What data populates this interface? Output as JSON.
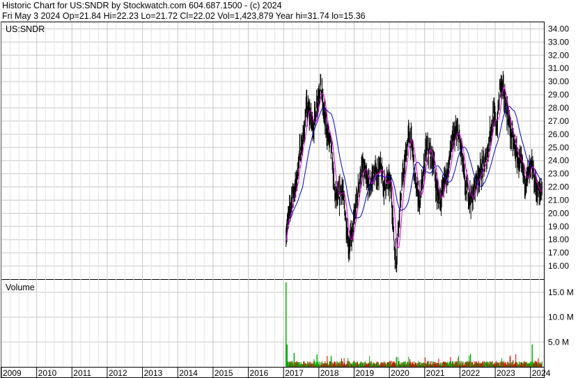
{
  "header": {
    "title": "Historic Chart for US:SNDR by Stockwatch.com 604.687.1500 - (c) 2024",
    "quote": "Fri May  3 2024   Op=21.84  Hi=22.23  Lo=21.72  Cl=22.02  Vol=1,423,879  Year hi=31.74  lo=15.36"
  },
  "price_panel": {
    "label": "US:SNDR"
  },
  "volume_panel": {
    "label": "Volume"
  },
  "colors": {
    "bars": "#000000",
    "ma_short": "#e000e0",
    "ma_long": "#0000d0",
    "vol_up": "#00b000",
    "vol_down": "#e00000",
    "grid": "#c8c8c8"
  },
  "chart_data": [
    {
      "type": "line",
      "title": "US:SNDR",
      "price_ticks": [
        "16.00",
        "17.00",
        "18.00",
        "19.00",
        "20.00",
        "21.00",
        "22.00",
        "23.00",
        "24.00",
        "25.00",
        "26.00",
        "27.00",
        "28.00",
        "29.00",
        "30.00",
        "31.00",
        "32.00",
        "33.00",
        "34.00"
      ],
      "ylim": [
        15,
        34.5
      ],
      "x_ticks": [
        "2009",
        "2010",
        "2011",
        "2012",
        "2013",
        "2014",
        "2015",
        "2016",
        "2017",
        "2018",
        "2019",
        "2020",
        "2021",
        "2022",
        "2023",
        "2024"
      ],
      "series": [
        {
          "x": [
            2017.07,
            2017.15,
            2017.25,
            2017.35,
            2017.45,
            2017.55,
            2017.65,
            2017.75,
            2017.85,
            2017.95,
            2018.05,
            2018.15,
            2018.25,
            2018.35,
            2018.45,
            2018.55,
            2018.65,
            2018.75,
            2018.85,
            2018.95,
            2019.05,
            2019.15,
            2019.25,
            2019.35,
            2019.45,
            2019.55,
            2019.65,
            2019.75,
            2019.85,
            2019.95,
            2020.05,
            2020.15,
            2020.2,
            2020.25,
            2020.35,
            2020.45,
            2020.55,
            2020.65,
            2020.75,
            2020.85,
            2020.95,
            2021.05,
            2021.15,
            2021.25,
            2021.35,
            2021.45,
            2021.55,
            2021.65,
            2021.75,
            2021.85,
            2021.95,
            2022.05,
            2022.15,
            2022.25,
            2022.35,
            2022.45,
            2022.55,
            2022.65,
            2022.75,
            2022.85,
            2022.95,
            2023.05,
            2023.15,
            2023.25,
            2023.35,
            2023.45,
            2023.55,
            2023.65,
            2023.75,
            2023.85,
            2023.95,
            2024.05,
            2024.15,
            2024.25,
            2024.34
          ],
          "values": [
            18.5,
            19.8,
            21.5,
            22.0,
            24.5,
            25.5,
            28.0,
            27.5,
            26.5,
            28.5,
            29.8,
            27.5,
            26.0,
            25.0,
            21.5,
            21.0,
            22.0,
            20.0,
            17.5,
            18.5,
            20.5,
            22.5,
            23.5,
            22.5,
            22.0,
            23.0,
            23.0,
            23.5,
            22.0,
            22.5,
            22.0,
            17.0,
            16.5,
            19.0,
            22.0,
            24.0,
            26.0,
            25.0,
            22.0,
            21.0,
            22.5,
            25.0,
            24.5,
            24.0,
            21.5,
            21.0,
            22.5,
            23.0,
            25.0,
            26.0,
            26.0,
            24.5,
            22.0,
            21.5,
            21.0,
            22.5,
            23.0,
            23.5,
            24.0,
            26.0,
            27.5,
            26.5,
            30.0,
            29.0,
            27.5,
            26.0,
            25.0,
            24.0,
            23.5,
            22.5,
            23.0,
            23.5,
            22.0,
            21.5,
            22.0
          ]
        }
      ]
    },
    {
      "type": "bar",
      "title": "Volume",
      "volume_ticks": [
        "5.0 M",
        "10.0 M",
        "15.0 M"
      ],
      "ylim": [
        0,
        17.5
      ],
      "volume_spikes": [
        {
          "x": 2017.07,
          "values": 17.0
        },
        {
          "x": 2017.1,
          "values": 4.5
        },
        {
          "x": 2017.3,
          "values": 2.8
        },
        {
          "x": 2017.95,
          "values": 2.5
        },
        {
          "x": 2018.35,
          "values": 2.2
        },
        {
          "x": 2020.2,
          "values": 2.0
        },
        {
          "x": 2022.3,
          "values": 2.6
        },
        {
          "x": 2024.05,
          "values": 4.5
        }
      ]
    }
  ]
}
